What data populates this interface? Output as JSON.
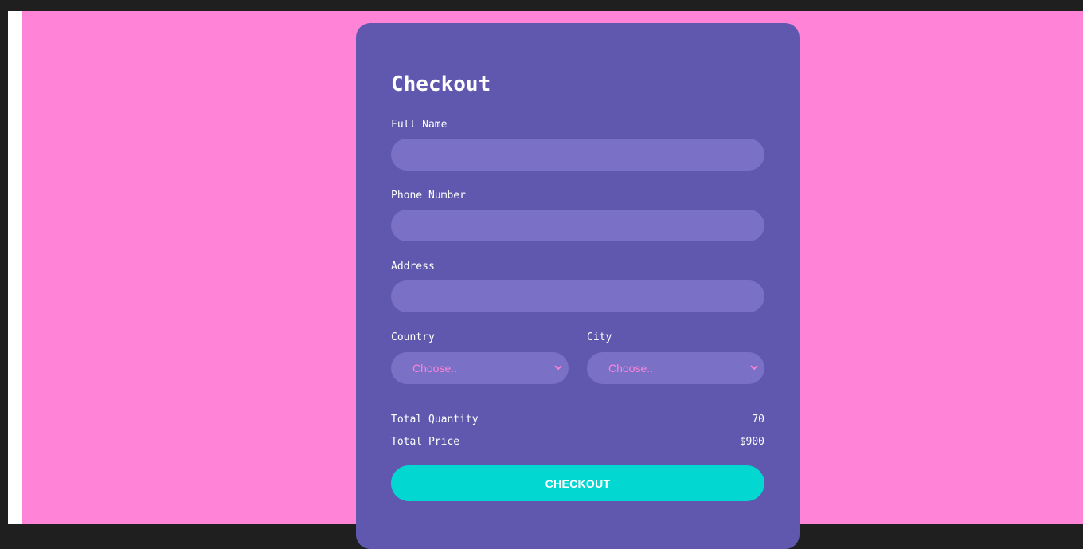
{
  "form": {
    "title": "Checkout",
    "full_name": {
      "label": "Full Name",
      "value": "",
      "placeholder": ""
    },
    "phone": {
      "label": "Phone Number",
      "value": "",
      "placeholder": ""
    },
    "address": {
      "label": "Address",
      "value": "",
      "placeholder": ""
    },
    "country": {
      "label": "Country",
      "selected": "Choose.."
    },
    "city": {
      "label": "City",
      "selected": "Choose.."
    }
  },
  "summary": {
    "quantity_label": "Total Quantity",
    "quantity_value": "70",
    "price_label": "Total Price",
    "price_value": "$900"
  },
  "actions": {
    "checkout_label": "CHECKOUT"
  },
  "colors": {
    "page_background": "#ff84d8",
    "card_background": "#6058ae",
    "field_background": "#7a70c6",
    "select_text": "#ff84d8",
    "button_background": "#02d7d1"
  },
  "icons": {
    "select_chevron": "chevron-down-icon"
  }
}
